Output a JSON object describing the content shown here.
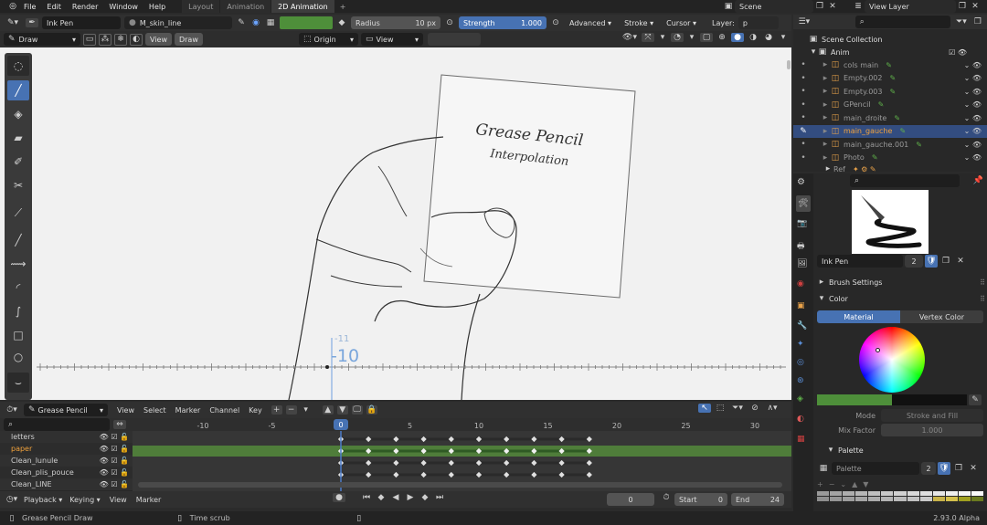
{
  "topbar": {
    "menus": [
      "File",
      "Edit",
      "Render",
      "Window",
      "Help"
    ],
    "workspaces": [
      "Layout",
      "Animation",
      "2D Animation"
    ],
    "active_workspace": "2D Animation",
    "add": "+",
    "scene": "Scene",
    "view_layer": "View Layer"
  },
  "tool_header": {
    "brush": "Ink Pen",
    "material": "M_skin_line",
    "radius_label": "Radius",
    "radius_value": "10 px",
    "strength_label": "Strength",
    "strength_value": "1.000",
    "advanced": "Advanced",
    "stroke": "Stroke",
    "cursor": "Cursor",
    "layer": "Layer:",
    "layer_short": "p"
  },
  "viewport_header": {
    "mode": "Draw",
    "view": "View",
    "draw": "Draw",
    "origin": "Origin",
    "view2": "View"
  },
  "viewport": {
    "frame_prev": "-11",
    "frame_current": "-10",
    "drawing_line1": "Grease Pencil",
    "drawing_line2": "Interpolation"
  },
  "outliner": {
    "root": "Scene Collection",
    "collection": "Anim",
    "items": [
      {
        "name": "cols main",
        "selected": false
      },
      {
        "name": "Empty.002",
        "selected": false
      },
      {
        "name": "Empty.003",
        "selected": false
      },
      {
        "name": "GPencil",
        "selected": false
      },
      {
        "name": "main_droite",
        "selected": false
      },
      {
        "name": "main_gauche",
        "selected": true
      },
      {
        "name": "main_gauche.001",
        "selected": false
      },
      {
        "name": "Photo",
        "selected": false
      }
    ],
    "partial": "Ref"
  },
  "properties": {
    "brush_name": "Ink Pen",
    "brush_users": "2",
    "brush_settings": "Brush Settings",
    "color": "Color",
    "tab_material": "Material",
    "tab_vertex": "Vertex Color",
    "mode_label": "Mode",
    "mode_value": "Stroke and Fill",
    "mix_label": "Mix Factor",
    "mix_value": "1.000",
    "palette_header": "Palette",
    "palette_name": "Palette",
    "palette_users": "2",
    "colors": {
      "accent": "#4772b3",
      "green": "#4e8f3a",
      "orange": "#e8a24a"
    }
  },
  "dopesheet": {
    "mode": "Grease Pencil",
    "menus": [
      "View",
      "Select",
      "Marker",
      "Channel",
      "Key"
    ],
    "ruler": [
      "-10",
      "-5",
      "0",
      "5",
      "10",
      "15",
      "20",
      "25",
      "30"
    ],
    "current_frame": "0",
    "channels": [
      {
        "name": "letters",
        "active": false
      },
      {
        "name": "paper",
        "active": true
      },
      {
        "name": "Clean_lunule",
        "active": false
      },
      {
        "name": "Clean_plis_pouce",
        "active": false
      },
      {
        "name": "Clean_LINE",
        "active": false
      }
    ]
  },
  "timeline": {
    "playback": "Playback",
    "keying": "Keying",
    "view": "View",
    "marker": "Marker",
    "frame": "0",
    "start_label": "Start",
    "start": "0",
    "end_label": "End",
    "end": "24"
  },
  "statusbar": {
    "left": "Grease Pencil Draw",
    "mid": "Time scrub",
    "version": "2.93.0 Alpha"
  }
}
